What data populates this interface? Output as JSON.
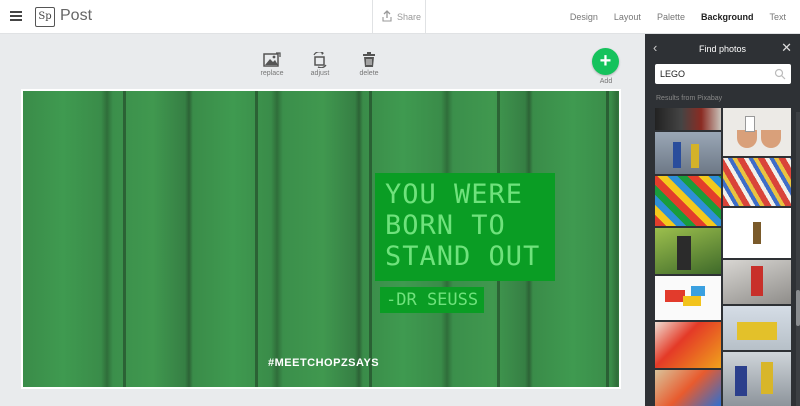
{
  "app": {
    "name": "Post",
    "logo_text": "Sp"
  },
  "topbar": {
    "share_label": "Share",
    "tabs": [
      "Design",
      "Layout",
      "Palette",
      "Background",
      "Text"
    ],
    "active_tab": "Background"
  },
  "toolbar": {
    "replace_label": "replace",
    "adjust_label": "adjust",
    "delete_label": "delete",
    "add_label": "Add"
  },
  "canvas": {
    "quote": "YOU WERE BORN TO STAND OUT",
    "quote_lines": [
      "YOU WERE",
      "BORN TO",
      "STAND OUT"
    ],
    "author": "-DR SEUSS",
    "hashtag": "#MEETCHOPZSAYS"
  },
  "panel": {
    "title": "Find photos",
    "search_value": "LEGO",
    "results_label": "Results from Pixabay"
  },
  "colors": {
    "accent_green": "#15c25c",
    "panel_bg": "#2e3135",
    "quote_bg": "#0a9d24",
    "quote_text": "#6fe27c"
  }
}
